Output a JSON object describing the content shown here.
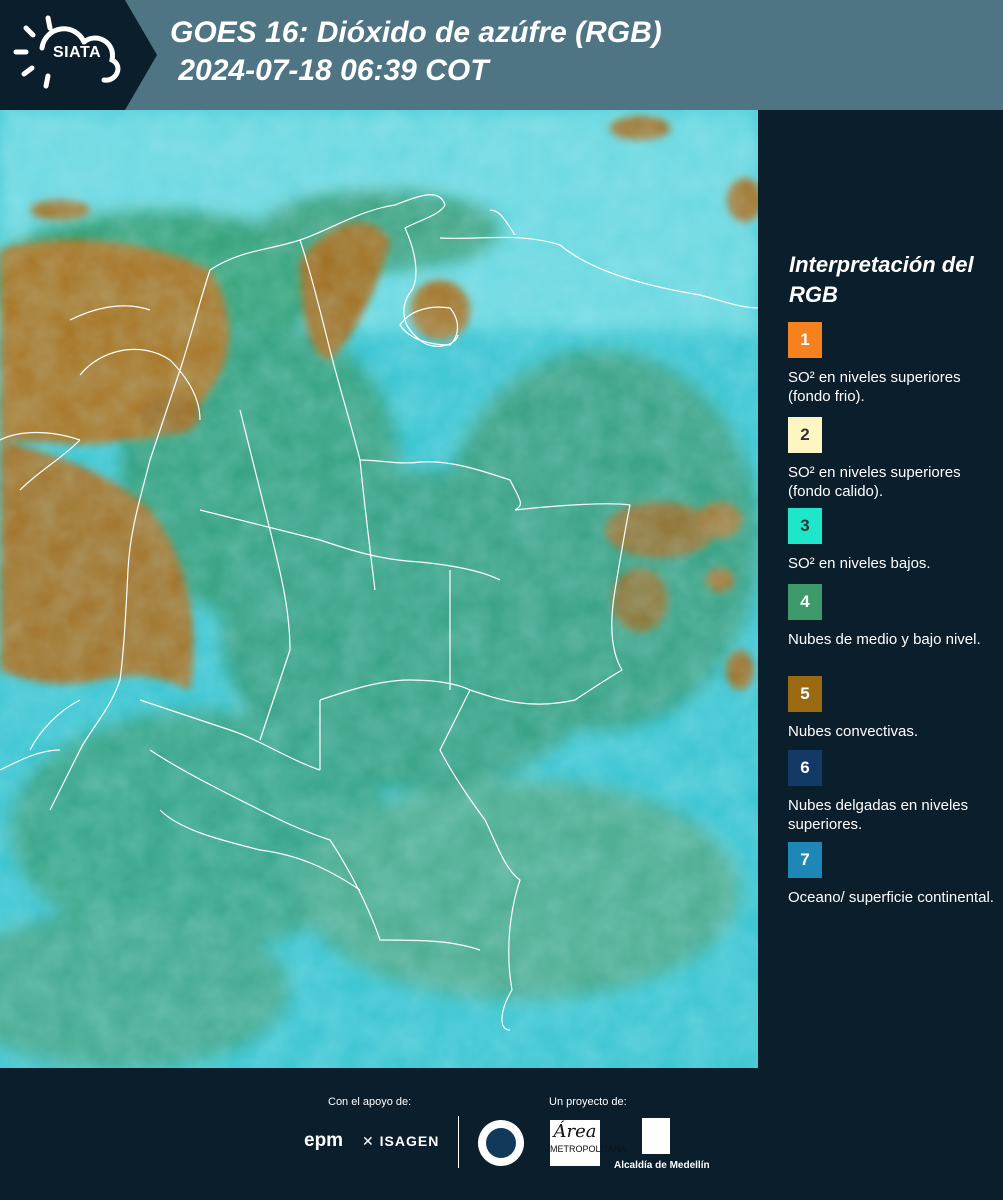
{
  "header": {
    "logo_text": "SIATA",
    "title_line1": "GOES 16: Dióxido de azúfre (RGB)",
    "title_line2": " 2024-07-18 06:39 COT"
  },
  "legend": {
    "title": "Interpretación del RGB",
    "items": [
      {
        "number": "1",
        "color": "#f5821f",
        "text": "SO² en niveles superiores (fondo frio)."
      },
      {
        "number": "2",
        "color": "#fdf6c3",
        "text": "SO² en niveles superiores (fondo calido)."
      },
      {
        "number": "3",
        "color": "#1ee6c8",
        "text": "SO² en niveles bajos."
      },
      {
        "number": "4",
        "color": "#3e9a6b",
        "text": "Nubes de medio y bajo nivel."
      },
      {
        "number": "5",
        "color": "#9a6a12",
        "text": "Nubes convectivas."
      },
      {
        "number": "6",
        "color": "#133a66",
        "text": "Nubes delgadas en niveles superiores."
      },
      {
        "number": "7",
        "color": "#1d88b8",
        "text": "Oceano/ superficie continental."
      }
    ]
  },
  "footer": {
    "support_label": "Con el apoyo de:",
    "project_label": "Un proyecto de:",
    "epm": "epm",
    "isagen": "ISAGEN",
    "area_big": "Área",
    "area_small": "METROPOLITANA",
    "alcaldia": "Alcaldía de Medellín"
  }
}
